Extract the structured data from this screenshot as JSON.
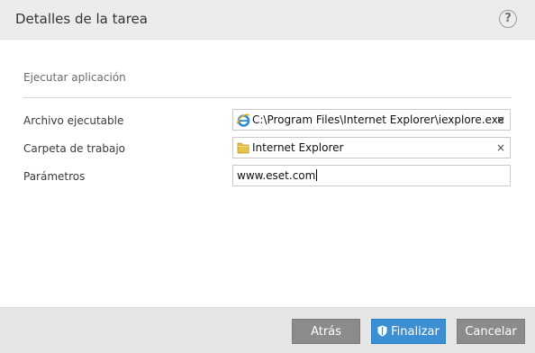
{
  "header": {
    "title": "Detalles de la tarea",
    "help_label": "?"
  },
  "section": {
    "title": "Ejecutar aplicación"
  },
  "fields": {
    "executable": {
      "label": "Archivo ejecutable",
      "value": "C:\\Program Files\\Internet Explorer\\iexplore.exe",
      "icon": "internet-explorer-icon",
      "clear": "×"
    },
    "workdir": {
      "label": "Carpeta de trabajo",
      "value": "Internet Explorer",
      "icon": "folder-icon",
      "clear": "×"
    },
    "params": {
      "label": "Parámetros",
      "value": "www.eset.com"
    }
  },
  "footer": {
    "back_label": "Atrás",
    "finish_label": "Finalizar",
    "cancel_label": "Cancelar"
  },
  "colors": {
    "primary_button": "#3d8fd4",
    "secondary_button": "#8b8b8b",
    "header_bg": "#ececec",
    "footer_bg": "#e6e6e6"
  }
}
